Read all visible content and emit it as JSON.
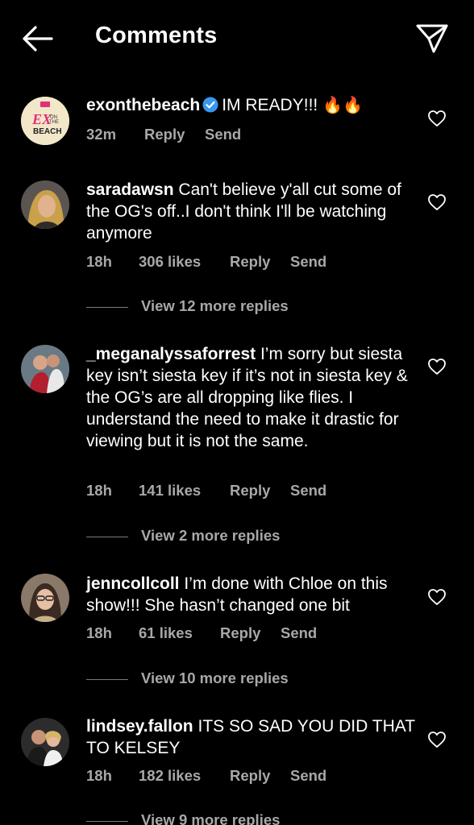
{
  "header": {
    "title": "Comments"
  },
  "comments": [
    {
      "username": "exonthebeach",
      "verified": true,
      "text": "IM READY!!!",
      "emoji": "🔥🔥",
      "time": "32m",
      "likes": "",
      "reply": "Reply",
      "send": "Send",
      "avatar_text": [
        "EX",
        "ON",
        "THE",
        "BEACH"
      ],
      "view_replies": ""
    },
    {
      "username": "saradawsn",
      "text": "Can't believe y'all cut some of the OG's off..I don't think I'll be watching anymore",
      "time": "18h",
      "likes": "306 likes",
      "reply": "Reply",
      "send": "Send",
      "view_replies": "View 12 more replies"
    },
    {
      "username": "_meganalyssaforrest",
      "text": "I’m sorry but siesta key isn’t siesta key if it’s not in siesta key & the OG’s are all dropping like flies. I understand the need to make it drastic for viewing but it is not the same.",
      "time": "18h",
      "likes": "141 likes",
      "reply": "Reply",
      "send": "Send",
      "view_replies": "View 2 more replies"
    },
    {
      "username": "jenncollcoll",
      "text": "I’m done with Chloe on this show!!! She hasn’t changed one bit",
      "time": "18h",
      "likes": "61 likes",
      "reply": "Reply",
      "send": "Send",
      "view_replies": "View 10 more replies"
    },
    {
      "username": "lindsey.fallon",
      "text": "ITS SO SAD YOU DID THAT TO KELSEY",
      "time": "18h",
      "likes": "182 likes",
      "reply": "Reply",
      "send": "Send",
      "view_replies": "View 9 more replies"
    }
  ],
  "colors": {
    "background": "#000000",
    "text": "#ffffff",
    "meta": "#a8a8a8",
    "verified": "#3897f0"
  },
  "icons": {
    "back": "arrow-left-icon",
    "share": "paper-plane-icon",
    "like": "heart-outline-icon",
    "verified": "verified-badge-icon"
  }
}
